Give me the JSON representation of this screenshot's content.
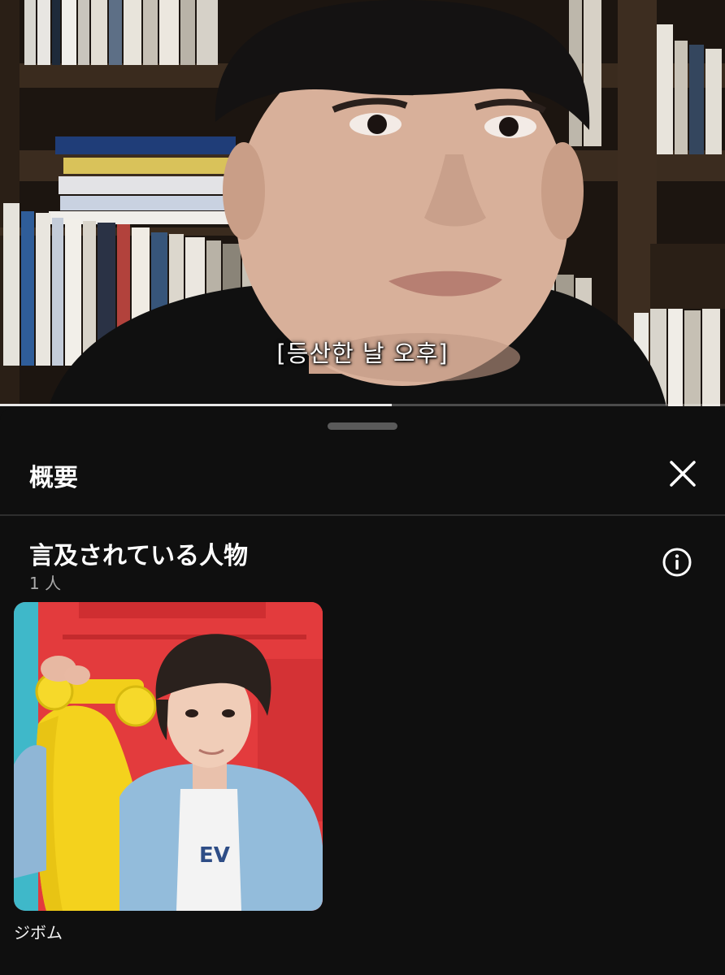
{
  "video": {
    "subtitle": "[등산한 날 오후]",
    "progress_fraction": 0.54
  },
  "sheet": {
    "title": "概要",
    "close_icon": "close-icon",
    "section": {
      "title": "言及されている人物",
      "count": "1 人",
      "info_icon": "info-icon"
    },
    "people": [
      {
        "name": "ジボム"
      }
    ]
  },
  "colors": {
    "background": "#0f0f0f",
    "divider": "#2e2e2e",
    "muted_text": "#aaaaaa"
  }
}
